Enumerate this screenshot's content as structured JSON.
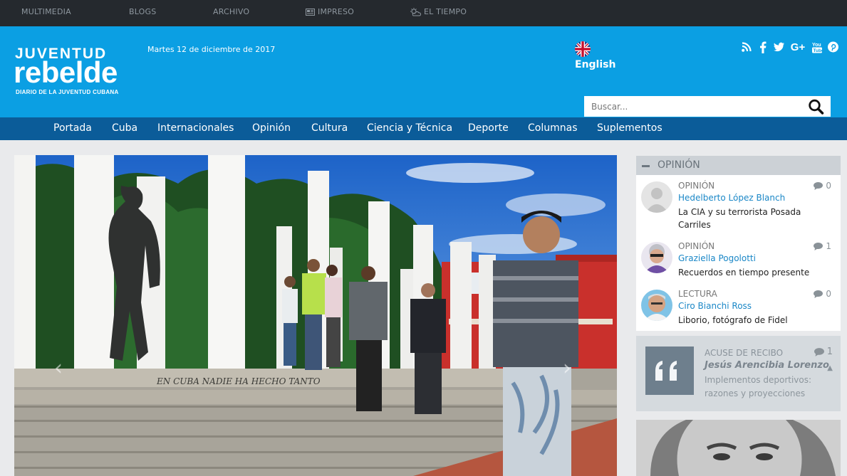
{
  "topbar": {
    "items": [
      {
        "label": "MULTIMEDIA",
        "icon": ""
      },
      {
        "label": "BLOGS",
        "icon": ""
      },
      {
        "label": "ARCHIVO",
        "icon": ""
      },
      {
        "label": "IMPRESO",
        "icon": "newspaper-icon"
      },
      {
        "label": "EL TIEMPO",
        "icon": "weather-icon"
      }
    ]
  },
  "header": {
    "logo_top": "JUVENTUD",
    "logo_main": "rebelde",
    "logo_tagline": "DIARIO DE LA JUVENTUD CUBANA",
    "date": "Martes 12 de diciembre de 2017",
    "language_label": "English",
    "search_placeholder": "Buscar...",
    "social_icons": [
      "rss-icon",
      "facebook-icon",
      "twitter-icon",
      "google-plus-icon",
      "youtube-icon",
      "pinterest-icon"
    ]
  },
  "nav": {
    "items": [
      "Portada",
      "Cuba",
      "Internacionales",
      "Opinión",
      "Cultura",
      "Ciencia y Técnica",
      "Deporte",
      "Columnas",
      "Suplementos"
    ]
  },
  "hero": {
    "inscription": "EN CUBA NADIE HA HECHO TANTO"
  },
  "sidebar": {
    "opinion_header": "OPINIÓN",
    "items": [
      {
        "category": "OPINIÓN",
        "author": "Hedelberto López Blanch",
        "title": "La CIA y su terrorista Posada Carriles",
        "comments": "0"
      },
      {
        "category": "OPINIÓN",
        "author": "Graziella Pogolotti",
        "title": "Recuerdos en tiempo presente",
        "comments": "1"
      },
      {
        "category": "LECTURA",
        "author": "Ciro Bianchi Ross",
        "title": "Liborio, fotógrafo de Fidel",
        "comments": "0"
      }
    ],
    "acuse": {
      "category": "ACUSE DE RECIBO",
      "author": "Jesús Arencibia Lorenzo",
      "title": "Implementos deportivos: razones y proyecciones",
      "comments": "1"
    }
  },
  "colors": {
    "topbar": "#25292e",
    "header": "#0b9fe3",
    "nav": "#0b5c99",
    "link": "#1a87c7"
  }
}
